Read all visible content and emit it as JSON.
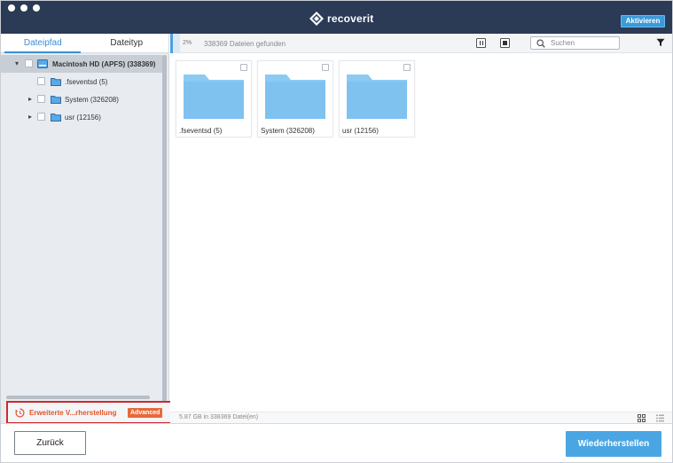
{
  "app": {
    "brand": "recoverit",
    "activate_label": "Aktivieren"
  },
  "sidebar": {
    "tabs": [
      {
        "label": "Dateipfad",
        "active": true
      },
      {
        "label": "Dateityp",
        "active": false
      }
    ],
    "tree": [
      {
        "label": "Macintosh HD (APFS) (338369)",
        "expanded": true,
        "selected": true,
        "icon": "hard-drive-icon"
      },
      {
        "label": ".fseventsd (5)",
        "expanded": false,
        "has_children": false,
        "icon": "folder-icon"
      },
      {
        "label": "System (326208)",
        "expanded": false,
        "has_children": true,
        "icon": "folder-icon"
      },
      {
        "label": "usr (12156)",
        "expanded": false,
        "has_children": true,
        "icon": "folder-icon"
      }
    ],
    "advanced": {
      "label": "Erweiterte V...rherstellung",
      "badge": "Advanced",
      "icon": "advanced-recovery-icon"
    }
  },
  "main": {
    "progress": {
      "percent_label": "2%",
      "percent": 2,
      "found_label": "338369 Dateien gefunden"
    },
    "search": {
      "placeholder": "Suchen",
      "value": ""
    },
    "files": [
      {
        "label": ".fseventsd (5)",
        "icon": "folder-icon"
      },
      {
        "label": "System (326208)",
        "icon": "folder-icon"
      },
      {
        "label": "usr (12156)",
        "icon": "folder-icon"
      }
    ],
    "status": {
      "size_label": "5.87 GB in 338369 Datei(en)"
    }
  },
  "footer": {
    "back_label": "Zurück",
    "restore_label": "Wiederherstellen"
  },
  "colors": {
    "titlebar": "#2b3a55",
    "accent": "#3a8ed4",
    "restore_button": "#4aa6e3",
    "folder": "#7fc2f0",
    "advanced_highlight": "#cc2a2f",
    "advanced_text": "#e0552d"
  }
}
